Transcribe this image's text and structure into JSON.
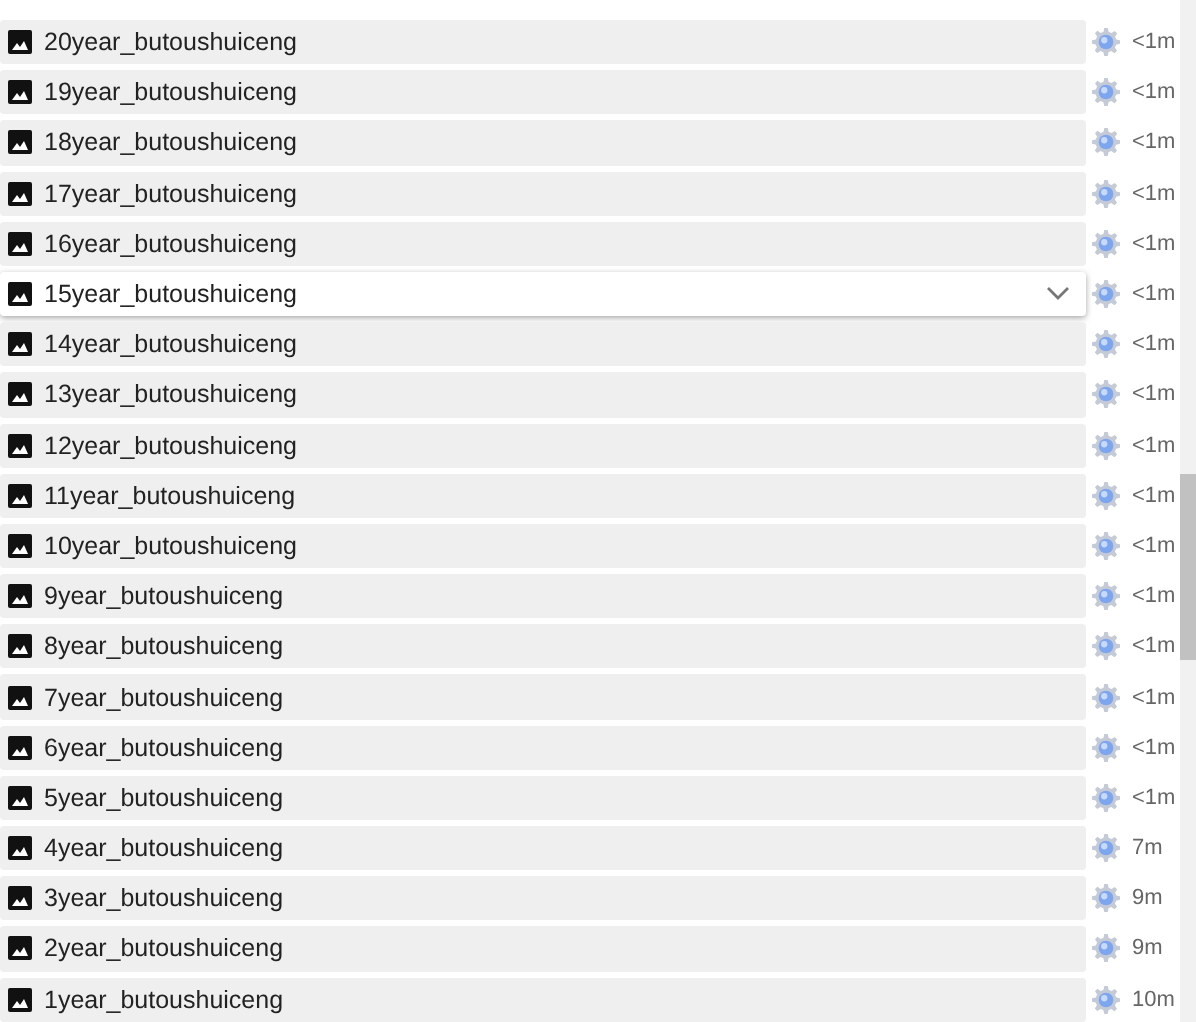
{
  "layers": [
    {
      "name": "20year_butoushuiceng",
      "time": "<1m",
      "selected": false
    },
    {
      "name": "19year_butoushuiceng",
      "time": "<1m",
      "selected": false
    },
    {
      "name": "18year_butoushuiceng",
      "time": "<1m",
      "selected": false
    },
    {
      "name": "17year_butoushuiceng",
      "time": "<1m",
      "selected": false
    },
    {
      "name": "16year_butoushuiceng",
      "time": "<1m",
      "selected": false
    },
    {
      "name": "15year_butoushuiceng",
      "time": "<1m",
      "selected": true
    },
    {
      "name": "14year_butoushuiceng",
      "time": "<1m",
      "selected": false
    },
    {
      "name": "13year_butoushuiceng",
      "time": "<1m",
      "selected": false
    },
    {
      "name": "12year_butoushuiceng",
      "time": "<1m",
      "selected": false
    },
    {
      "name": "11year_butoushuiceng",
      "time": "<1m",
      "selected": false
    },
    {
      "name": "10year_butoushuiceng",
      "time": "<1m",
      "selected": false
    },
    {
      "name": "9year_butoushuiceng",
      "time": "<1m",
      "selected": false
    },
    {
      "name": "8year_butoushuiceng",
      "time": "<1m",
      "selected": false
    },
    {
      "name": "7year_butoushuiceng",
      "time": "<1m",
      "selected": false
    },
    {
      "name": "6year_butoushuiceng",
      "time": "<1m",
      "selected": false
    },
    {
      "name": "5year_butoushuiceng",
      "time": "<1m",
      "selected": false
    },
    {
      "name": "4year_butoushuiceng",
      "time": "7m",
      "selected": false
    },
    {
      "name": "3year_butoushuiceng",
      "time": "9m",
      "selected": false
    },
    {
      "name": "2year_butoushuiceng",
      "time": "9m",
      "selected": false
    },
    {
      "name": "1year_butoushuiceng",
      "time": "10m",
      "selected": false
    }
  ]
}
